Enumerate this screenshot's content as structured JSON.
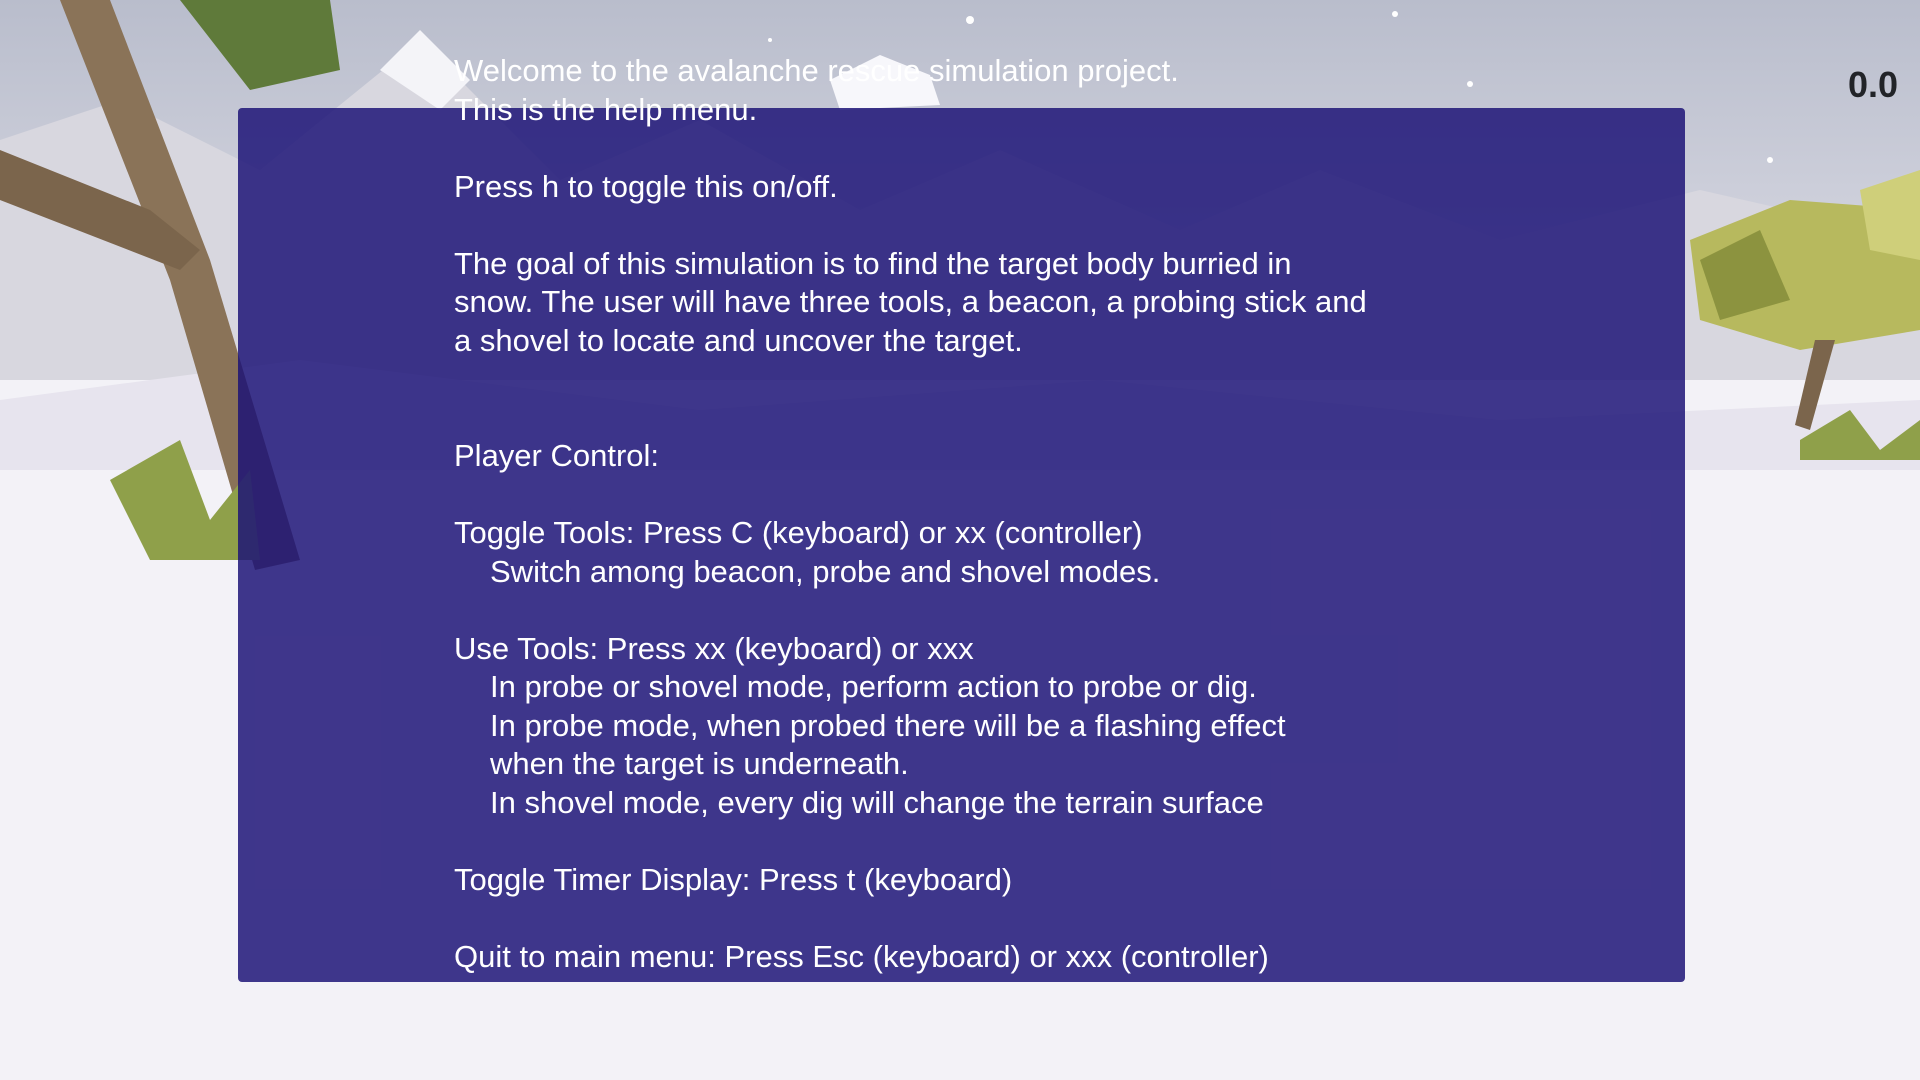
{
  "help_menu": {
    "welcome_line": "Welcome to the avalanche rescue simulation project.",
    "intro_line": "This is the help menu.",
    "toggle_hint": "Press h to toggle this on/off.",
    "goal_lines": [
      "The goal of this simulation is to find the target body burried in",
      "snow. The user will have three tools, a beacon, a probing stick and",
      "a shovel to locate and uncover the target."
    ],
    "player_control_heading": "Player Control:",
    "toggle_tools": {
      "label": "Toggle Tools:  Press C (keyboard) or xx (controller)",
      "details": [
        "Switch among beacon, probe and shovel modes."
      ]
    },
    "use_tools": {
      "label": "Use Tools:  Press xx (keyboard) or xxx",
      "details": [
        "In probe or shovel mode, perform action to probe or dig.",
        "In probe mode, when probed there will be a flashing effect",
        "when the target is underneath.",
        "In shovel mode, every dig will change the terrain surface"
      ]
    },
    "toggle_timer": "Toggle Timer Display:    Press t (keyboard)",
    "quit": "Quit to main menu: Press Esc (keyboard) or xxx (controller)"
  },
  "timer": {
    "value": "0.0"
  },
  "colors": {
    "panel": "#1c1276",
    "text": "#ffffff",
    "timer_text": "#222428",
    "snow": "#f3f2f7",
    "sky": "#c8ccd8",
    "foliage": "#8fa04a",
    "trunk": "#8a7358"
  }
}
